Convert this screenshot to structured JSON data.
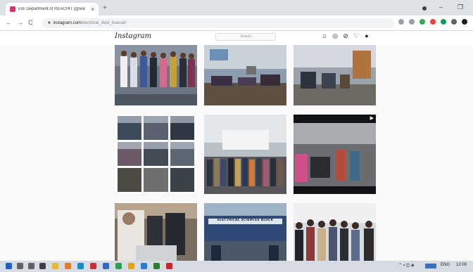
{
  "browser": {
    "tab_title": "EIE Department of REACHIT (@ele",
    "tab_close": "×",
    "new_tab": "+",
    "address_host": "instagram.com",
    "address_path": "/electrical_dept_bsacuk/",
    "back": "←",
    "forward": "→",
    "reload": "C",
    "minimize": "–",
    "maximize": "❐"
  },
  "instagram": {
    "logo": "Instagram",
    "search_placeholder": "Search",
    "nav_icons": [
      "home-icon",
      "direct-icon",
      "explore-icon",
      "activity-icon",
      "profile-icon"
    ],
    "video_badge": "▶"
  },
  "feed": {
    "banner_text": "ELECTRICAL SCIENCES BLOCK",
    "grid_rows": 3,
    "grid_cols": 3
  },
  "taskbar": {
    "language": "ENG",
    "time": "12:00"
  }
}
